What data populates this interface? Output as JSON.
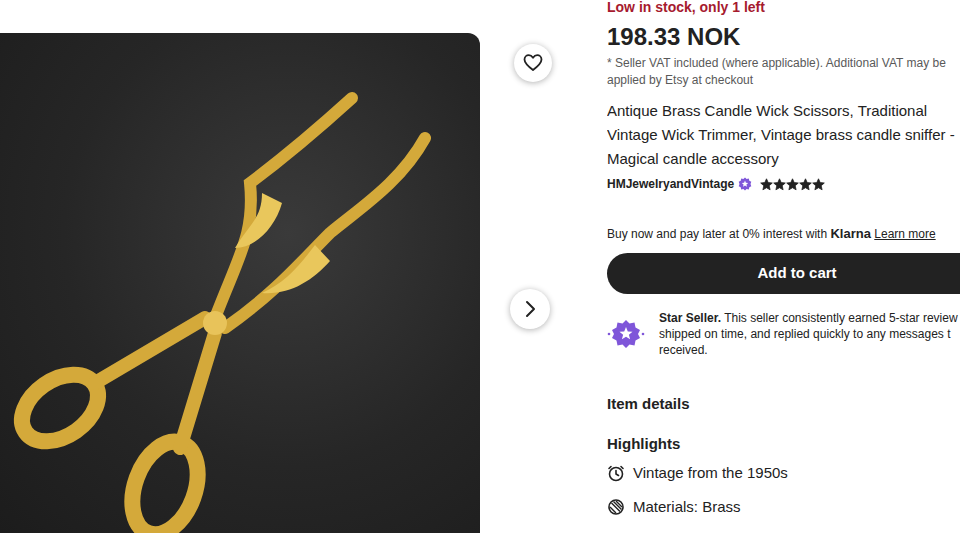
{
  "photo": {
    "favorited": false
  },
  "stock_notice": "Low in stock, only 1 left",
  "price": "198.33 NOK",
  "vat_note": [
    "* Seller VAT included (where applicable). Additional VAT may be",
    "applied by Etsy at checkout"
  ],
  "title": [
    "Antique Brass Candle Wick Scissors, Traditional",
    "Vintage Wick Trimmer, Vintage brass candle sniffer -",
    "Magical candle accessory"
  ],
  "seller": {
    "name": "HMJewelryandVintage",
    "stars": 5
  },
  "klarna": {
    "text": "Buy now and pay later at 0% interest with",
    "brand": "Klarna",
    "link": "Learn more"
  },
  "cart_button": "Add to cart",
  "star_seller": {
    "label": "Star Seller.",
    "lines": [
      "This seller consistently earned 5-star review",
      "shipped on time, and replied quickly to any messages t",
      "received."
    ]
  },
  "item_details": "Item details",
  "highlights": {
    "title": "Highlights",
    "items": [
      {
        "text": "Vintage from the 1950s",
        "kind": "clock"
      },
      {
        "text": "Materials: Brass",
        "kind": "materials"
      }
    ]
  }
}
